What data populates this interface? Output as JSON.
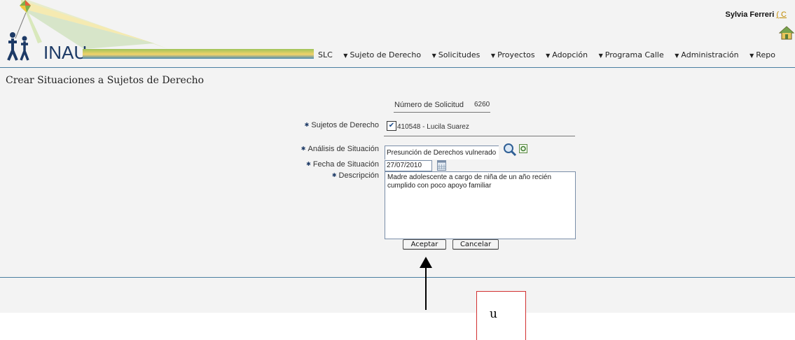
{
  "header": {
    "brand": "INAU",
    "user_name": "Sylvia Ferreri",
    "logout_fragment": "( C",
    "menu": [
      "SLC",
      "Sujeto de Derecho",
      "Solicitudes",
      "Proyectos",
      "Adopción",
      "Programa Calle",
      "Administración",
      "Repo"
    ]
  },
  "page_title": "Crear Situaciones a Sujetos de Derecho",
  "form": {
    "request_label": "Número de Solicitud",
    "request_number": "6260",
    "subjects_label": "Sujetos de Derecho",
    "subject_value": "410548 - Lucila Suarez",
    "subject_checked": true,
    "analysis_label": "Análisis de Situación",
    "analysis_value": "Presunción de Derechos vulnerado",
    "date_label": "Fecha de Situación",
    "date_value": "27/07/2010",
    "description_label": "Descripción",
    "description_value": "Madre adolescente a cargo de niña de un año recién\ncumplido con poco apoyo familiar",
    "accept_label": "Aceptar",
    "cancel_label": "Cancelar"
  },
  "annotation": {
    "callout_text": "u"
  },
  "colors": {
    "accent": "#1d3a66",
    "rule": "#4a7fa1",
    "callout_border": "#d23030"
  }
}
